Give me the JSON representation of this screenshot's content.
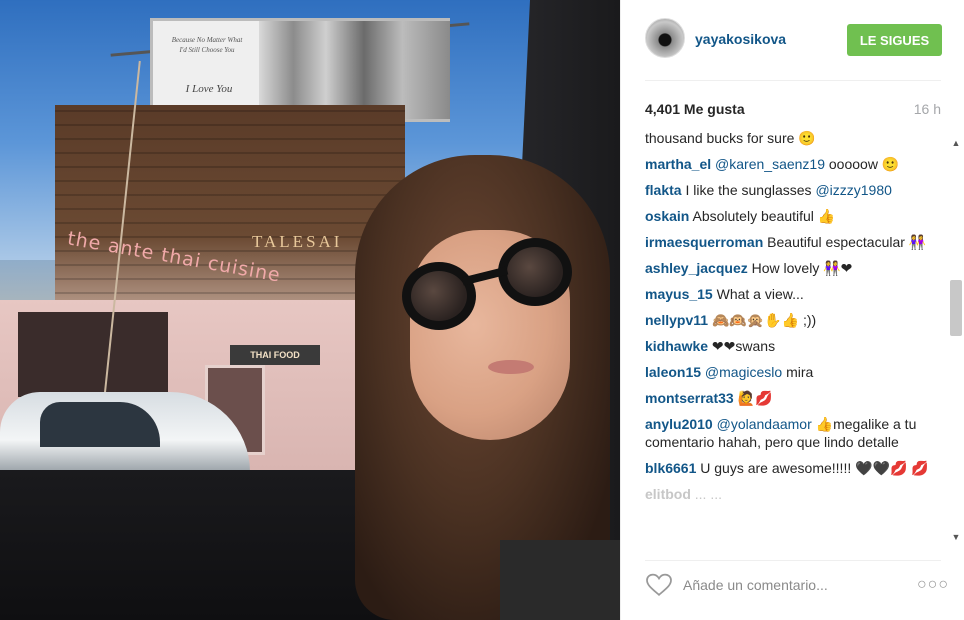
{
  "photo": {
    "billboard_line1": "Because No Matter What",
    "billboard_line2": "I'd Still Choose You",
    "billboard_big": "I Love You",
    "sign_restaurant": "the ante thai cuisine",
    "sign_talesai": "TALESAI",
    "sign_thaifood": "THAI FOOD"
  },
  "header": {
    "username": "yayakosikova",
    "follow_label": "LE SIGUES",
    "follow_color": "#70c050",
    "link_color": "#125688"
  },
  "meta": {
    "likes": "4,401 Me gusta",
    "time": "16 h"
  },
  "comments": [
    {
      "user": "",
      "mention": "",
      "text": "thousand bucks for sure 🙂"
    },
    {
      "user": "martha_el",
      "mention": "@karen_saenz19",
      "text": "ooooow 🙂"
    },
    {
      "user": "flakta",
      "mention": "",
      "text": "I like the sunglasses",
      "mention_after": "@izzzy1980"
    },
    {
      "user": "oskain",
      "mention": "",
      "text": "Absolutely beautiful 👍"
    },
    {
      "user": "irmaesquerroman",
      "mention": "",
      "text": "Beautiful espectacular 👭"
    },
    {
      "user": "ashley_jacquez",
      "mention": "",
      "text": "How lovely 👭❤"
    },
    {
      "user": "mayus_15",
      "mention": "",
      "text": "What a view..."
    },
    {
      "user": "nellypv11",
      "mention": "",
      "text": "🙈🙉🙊✋👍 ;))"
    },
    {
      "user": "kidhawke",
      "mention": "",
      "text": "❤❤swans"
    },
    {
      "user": "laleon15",
      "mention": "@magiceslo",
      "text": "mira"
    },
    {
      "user": "montserrat33",
      "mention": "",
      "text": "🙋💋"
    },
    {
      "user": "anylu2010",
      "mention": "@yolandaamor",
      "text": "👍megalike a tu comentario hahah, pero que lindo detalle"
    },
    {
      "user": "blk6661",
      "mention": "",
      "text": "U guys are awesome!!!!! 🖤🖤💋 💋"
    },
    {
      "user": "elitbod",
      "mention": "",
      "text": "... ..."
    }
  ],
  "footer": {
    "comment_placeholder": "Añade un comentario...",
    "more_label": "○○○"
  },
  "icons": {
    "heart": "heart-icon",
    "more": "more-options-icon",
    "scroll_up": "▲",
    "scroll_down": "▼"
  }
}
